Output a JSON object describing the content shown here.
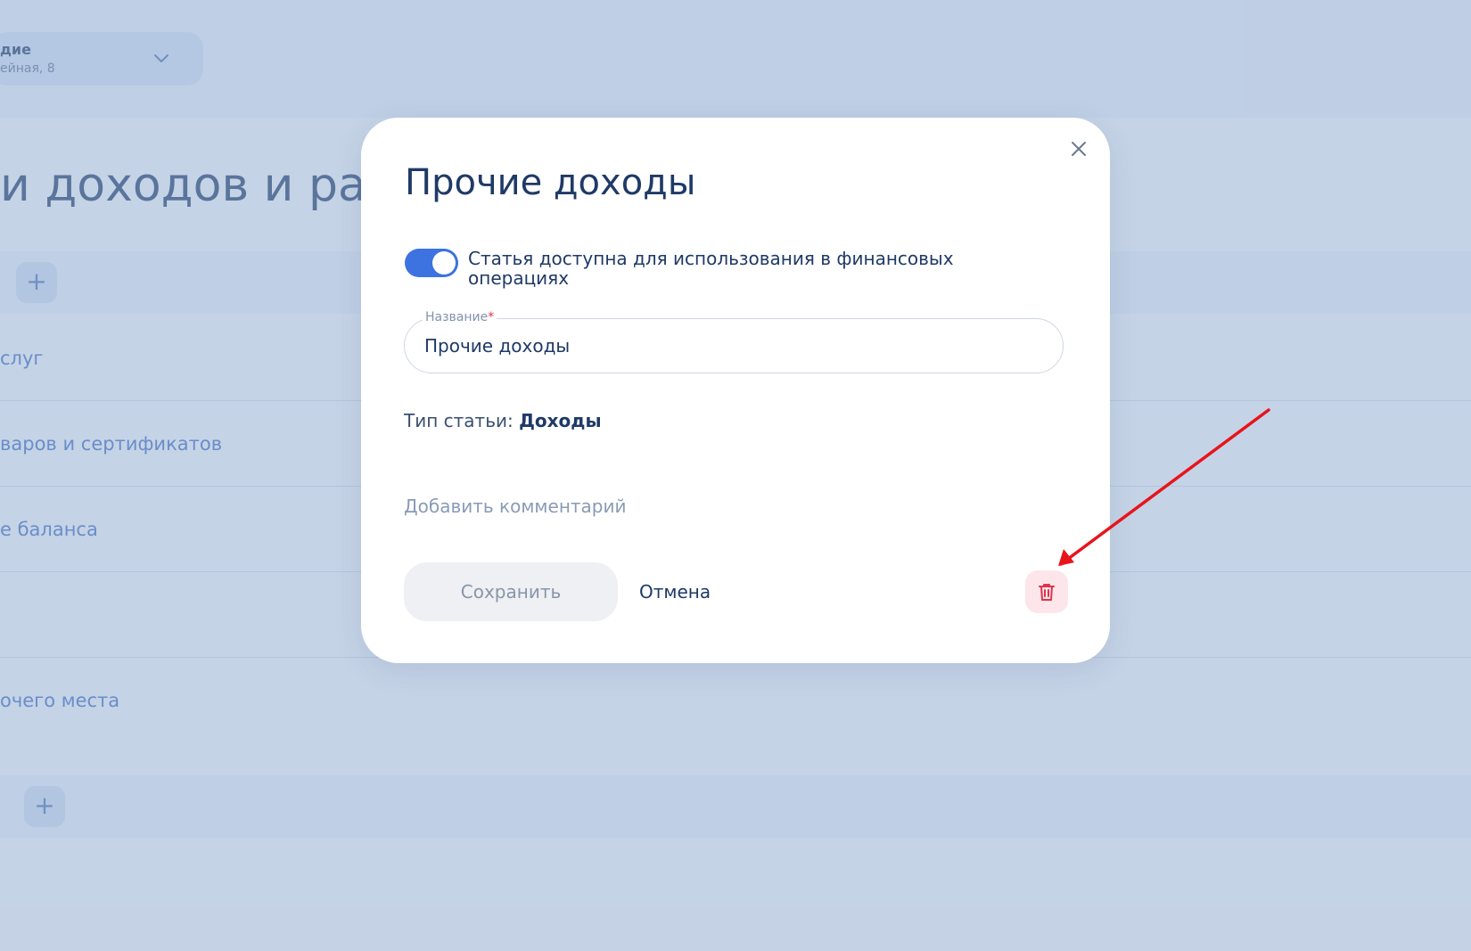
{
  "branch": {
    "name": "дие",
    "address": "ейная, 8"
  },
  "page": {
    "title": "и доходов и ра",
    "rows": [
      "слуг",
      "варов и сертификатов",
      "е баланса",
      "очего места"
    ],
    "add_symbol": "+"
  },
  "modal": {
    "title": "Прочие доходы",
    "toggle_label": "Статья доступна для использования в финансовых операциях",
    "toggle_on": true,
    "name_field": {
      "label": "Название",
      "required_mark": "*",
      "value": "Прочие доходы"
    },
    "type_label": "Тип статьи:",
    "type_value": "Доходы",
    "add_comment": "Добавить комментарий",
    "save_label": "Сохранить",
    "cancel_label": "Отмена"
  },
  "icons": {
    "close": "close-icon",
    "delete": "trash-icon",
    "chevron": "chevron-down-icon",
    "add": "plus-icon"
  },
  "colors": {
    "accent": "#3d73e0",
    "title": "#1f3a66",
    "delete": "#e0334a",
    "delete_bg": "#fde6ea",
    "arrow": "#e8141b"
  }
}
